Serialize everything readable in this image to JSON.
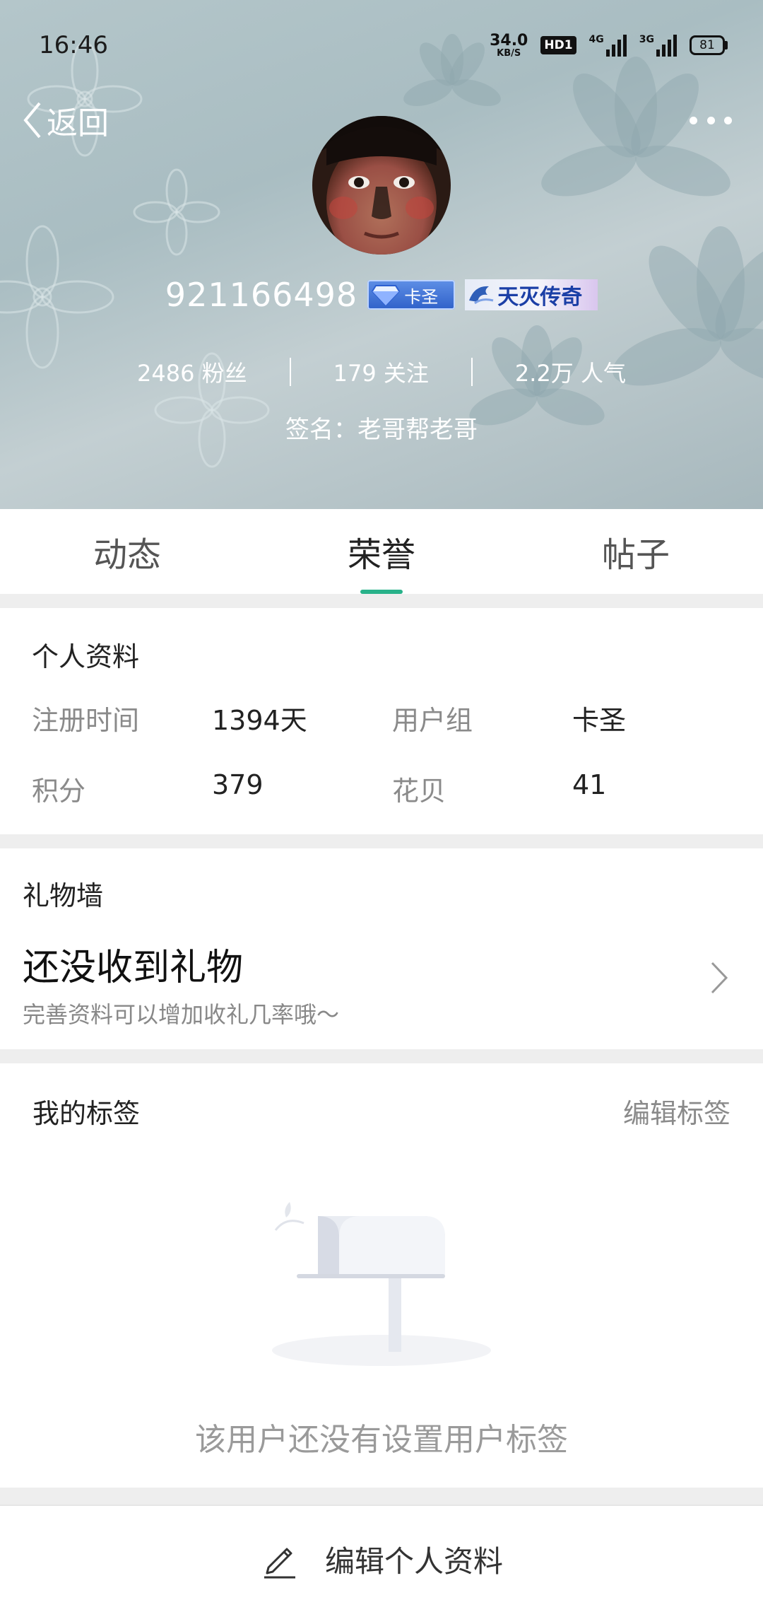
{
  "status_bar": {
    "time": "16:46",
    "net_speed_value": "34.0",
    "net_speed_unit": "KB/S",
    "hd_label": "HD1",
    "sim1_label": "4G",
    "sim2_label": "3G",
    "battery": "81"
  },
  "nav": {
    "back_label": "返回"
  },
  "profile": {
    "username": "921166498",
    "badge_rank": "卡圣",
    "badge_title": "天灭传奇",
    "stats": {
      "fans": "2486 粉丝",
      "following": "179 关注",
      "popularity": "2.2万 人气"
    },
    "signature": "签名：老哥帮老哥"
  },
  "tabs": [
    {
      "label": "动态",
      "active": false
    },
    {
      "label": "荣誉",
      "active": true
    },
    {
      "label": "帖子",
      "active": false
    }
  ],
  "personal_info": {
    "title": "个人资料",
    "rows": [
      {
        "label1": "注册时间",
        "value1": "1394天",
        "label2": "用户组",
        "value2": "卡圣"
      },
      {
        "label1": "积分",
        "value1": "379",
        "label2": "花贝",
        "value2": "41"
      }
    ]
  },
  "gift_wall": {
    "title": "礼物墙",
    "main_text": "还没收到礼物",
    "sub_text": "完善资料可以增加收礼几率哦～"
  },
  "tags": {
    "title": "我的标签",
    "edit_label": "编辑标签",
    "empty_text": "该用户还没有设置用户标签"
  },
  "bottom": {
    "edit_profile_label": "编辑个人资料"
  },
  "colors": {
    "accent": "#28b28a",
    "header_bg": "#b4c6ca"
  }
}
